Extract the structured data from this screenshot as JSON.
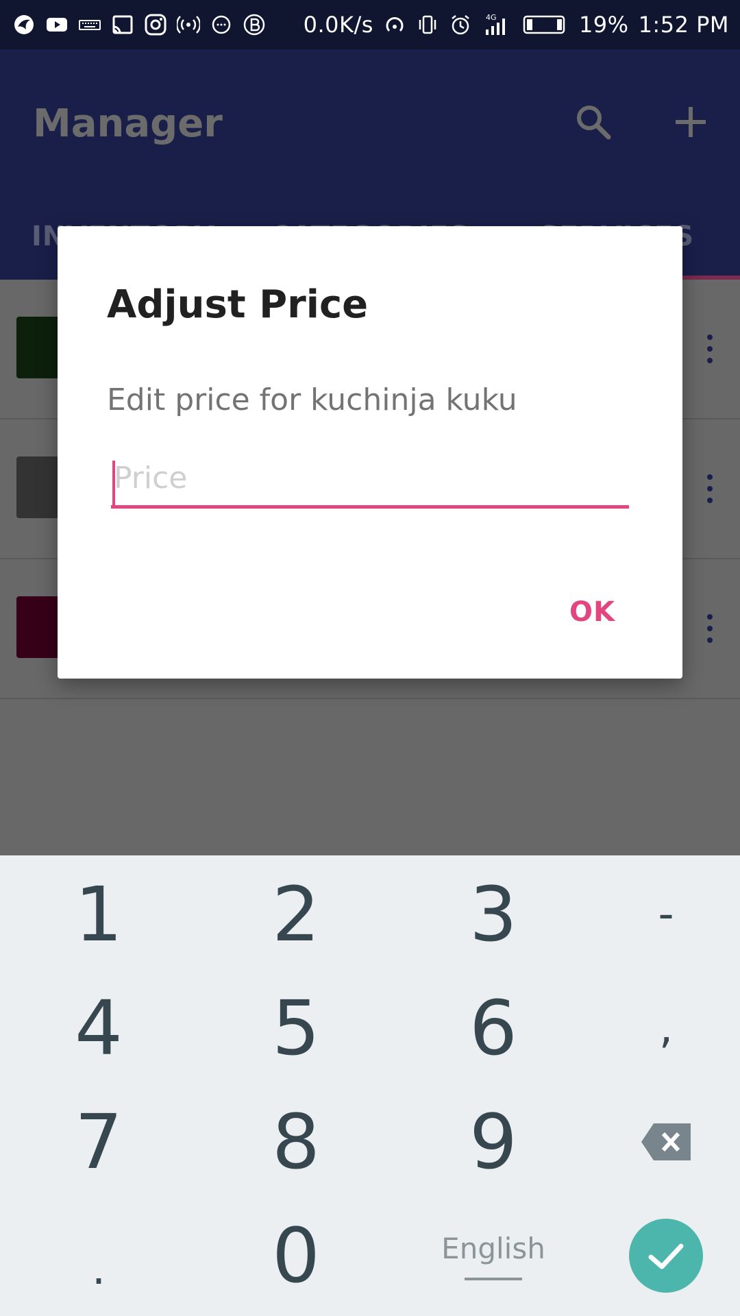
{
  "status_bar": {
    "left_icons": [
      "bird-icon",
      "youtube-icon",
      "keyboard-icon",
      "cast-icon",
      "instagram-icon",
      "hotspot-icon",
      "chat-icon",
      "b-icon"
    ],
    "net_speed": "0.0K/s",
    "network_type": "4G",
    "battery": "19%",
    "time": "1:52 PM"
  },
  "app_bar": {
    "title": "Manager",
    "actions": [
      "search-icon",
      "add-icon"
    ],
    "tabs": [
      {
        "label": "INVENTORY"
      },
      {
        "label": "CATEGORIES"
      },
      {
        "label": "SERVICES"
      }
    ],
    "selected_tab": 2
  },
  "list": {
    "rows": [
      {
        "color": "#0c200c"
      },
      {
        "color": "#333333"
      },
      {
        "color": "#360018"
      }
    ]
  },
  "dialog": {
    "title": "Adjust Price",
    "message": "Edit price for kuchinja kuku",
    "input": {
      "value": "",
      "placeholder": "Price"
    },
    "ok_label": "OK",
    "accent_color": "#e2457f"
  },
  "keyboard": {
    "rows": [
      [
        "1",
        "2",
        "3",
        "-"
      ],
      [
        "4",
        "5",
        "6",
        ","
      ],
      [
        "7",
        "8",
        "9",
        "backspace"
      ],
      [
        ".",
        "0",
        "English",
        "done"
      ]
    ],
    "language": "English",
    "done_color": "#4db6ac"
  }
}
